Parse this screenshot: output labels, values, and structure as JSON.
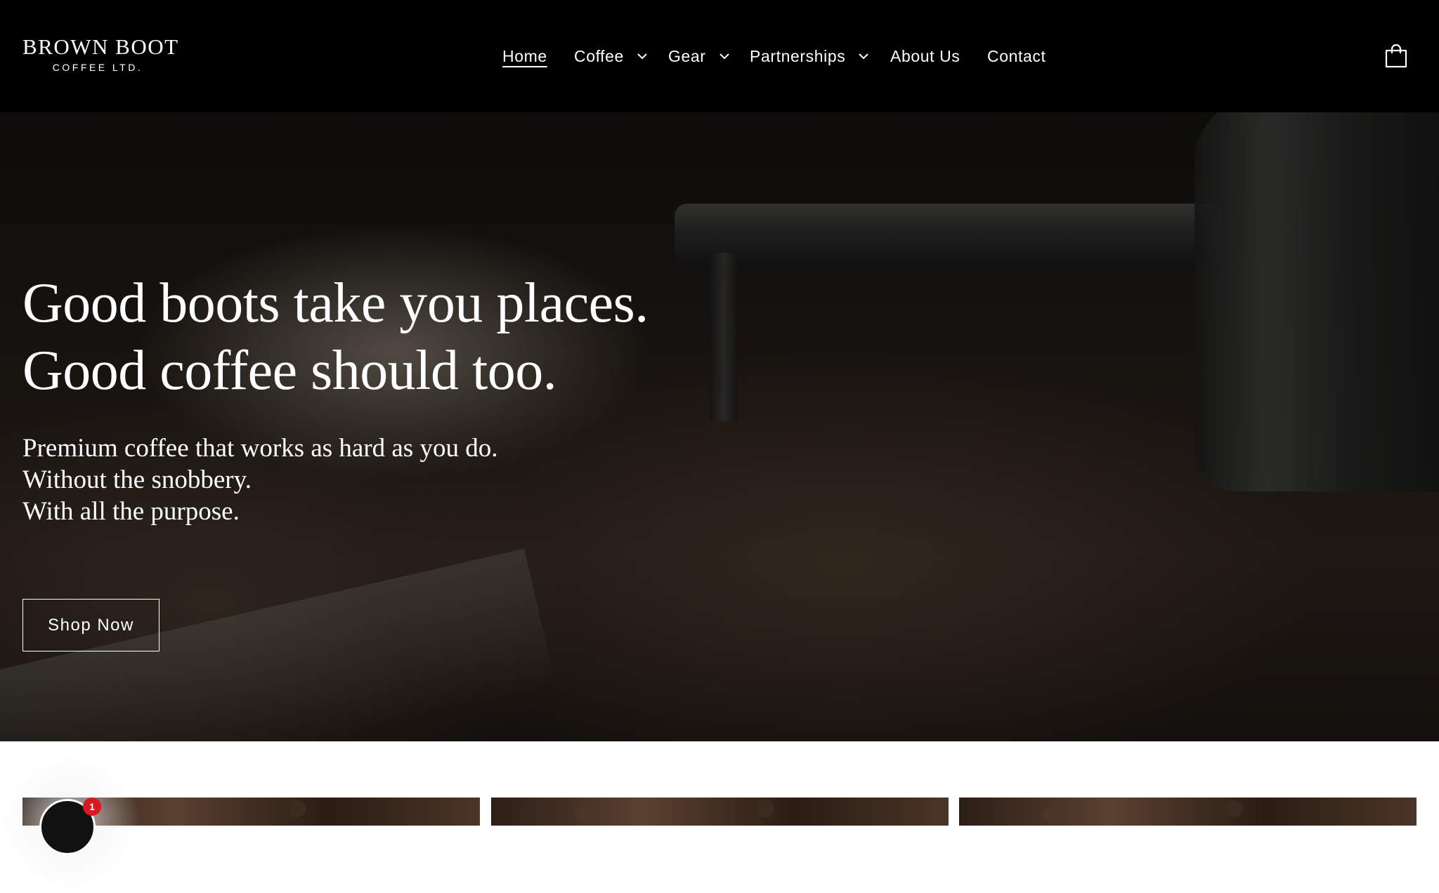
{
  "brand": {
    "name": "BROWN BOOT",
    "tagline": "COFFEE LTD."
  },
  "nav": {
    "items": [
      {
        "label": "Home",
        "active": true,
        "has_dropdown": false
      },
      {
        "label": "Coffee",
        "active": false,
        "has_dropdown": true
      },
      {
        "label": "Gear",
        "active": false,
        "has_dropdown": true
      },
      {
        "label": "Partnerships",
        "active": false,
        "has_dropdown": true
      },
      {
        "label": "About Us",
        "active": false,
        "has_dropdown": false
      },
      {
        "label": "Contact",
        "active": false,
        "has_dropdown": false
      }
    ],
    "cart_icon": "shopping-bag-icon"
  },
  "hero": {
    "title_lines": [
      "Good boots take you places.",
      "Good coffee should too."
    ],
    "subtitle_lines": [
      "Premium coffee that works as hard as you do.",
      "Without the snobbery.",
      "With all the purpose."
    ],
    "cta_label": "Shop Now"
  },
  "chat": {
    "badge_count": "1"
  },
  "colors": {
    "header_bg": "#000000",
    "text": "#ffffff",
    "badge": "#d71920"
  }
}
